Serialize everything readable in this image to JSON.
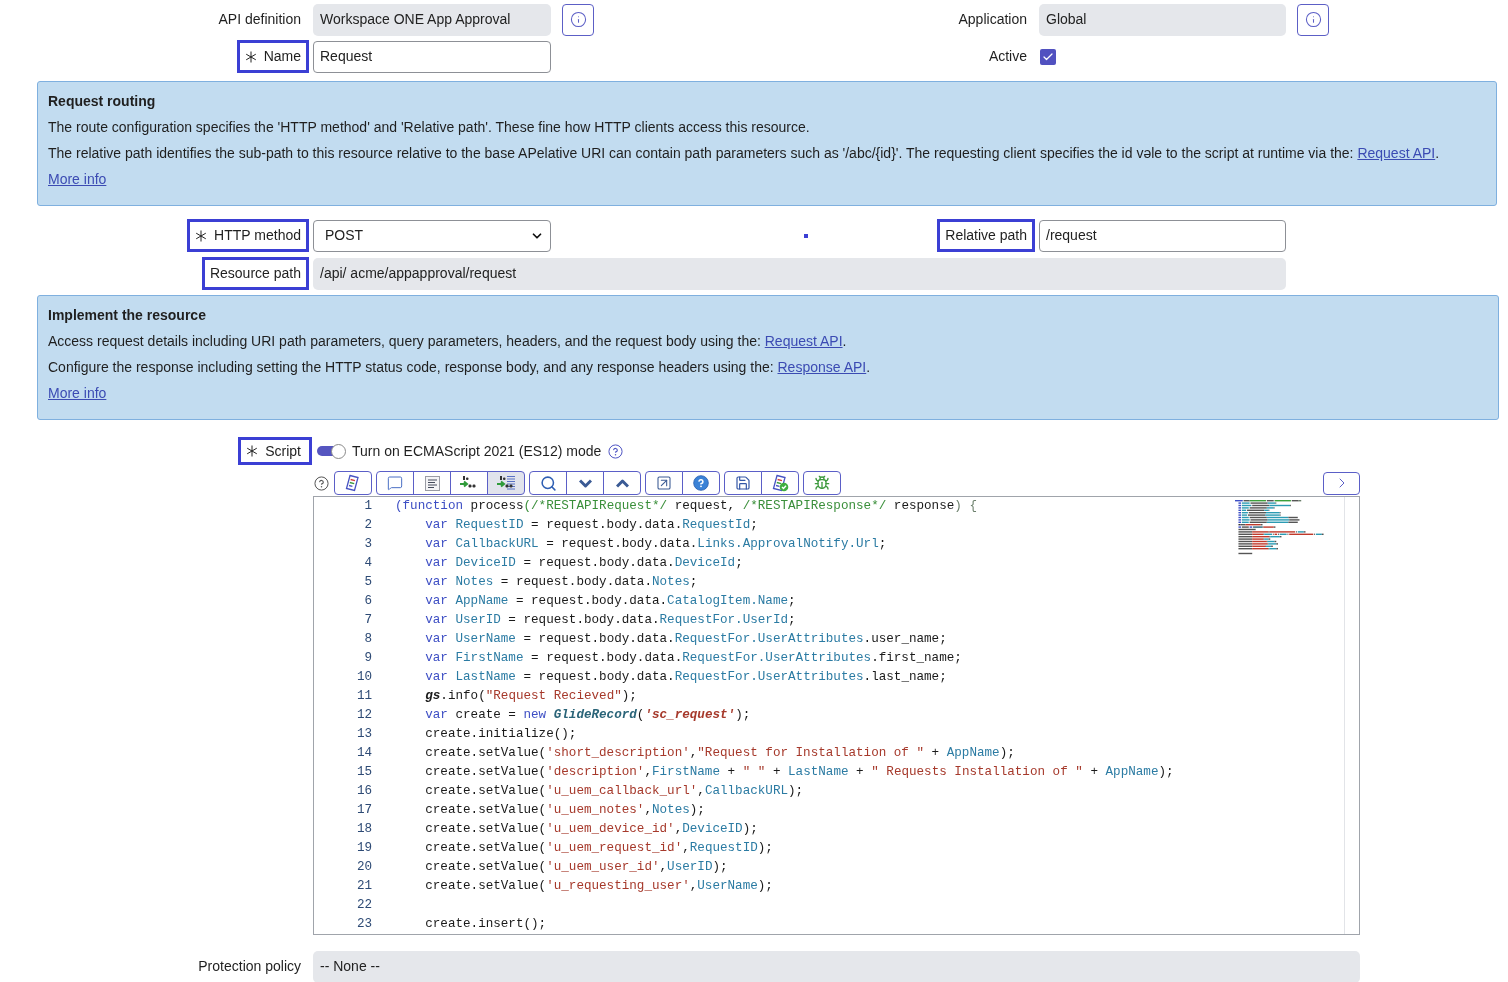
{
  "header": {
    "left": [
      {
        "kind": "readonly",
        "label": "API definition",
        "highlighted": false,
        "value": "Workspace ONE App Approval",
        "info_button": true
      },
      {
        "kind": "text",
        "label": "Name",
        "required": true,
        "highlighted": true,
        "value": "Request"
      }
    ],
    "right": [
      {
        "kind": "readonly",
        "label": "Application",
        "highlighted": false,
        "value": "Global",
        "info_button": true
      },
      {
        "kind": "checkbox",
        "label": "Active",
        "highlighted": false,
        "checked": true
      }
    ]
  },
  "request_routing": {
    "title": "Request routing",
    "paragraphs": [
      {
        "text": "The route configuration specifies the 'HTTP method' and 'Relative path'. These fine how HTTP clients access this resource."
      },
      {
        "text": "The relative path identifies the sub-path to this resource relative to the base APelative URI can contain path parameters such as '/abc/{id}'. The requesting client specifies the id vəle to the script at runtime via the: ",
        "link": "Request API",
        "text_after": "."
      }
    ],
    "more_info": "More info"
  },
  "routing_fields": {
    "http_method": {
      "kind": "select",
      "label": "HTTP method",
      "required": true,
      "highlighted": true,
      "value": "POST"
    },
    "relative_path": {
      "kind": "text",
      "label": "Relative path",
      "highlighted": true,
      "value": "/request"
    },
    "resource_path": {
      "kind": "readonly",
      "label": "Resource path",
      "highlighted": true,
      "value": "/api/ acme/appapproval/request"
    }
  },
  "implement_resource": {
    "title": "Implement the resource",
    "paragraphs": [
      {
        "text": "Access request details including URI path parameters, query parameters, headers, and the request body using the: ",
        "link": "Request API",
        "text_after": "."
      },
      {
        "text": "Configure the response including setting the HTTP status code, response body, and any response headers using the: ",
        "link": "Response API",
        "text_after": "."
      }
    ],
    "more_info": "More info"
  },
  "script": {
    "label": "Script",
    "required": true,
    "highlighted": true,
    "toggle": {
      "label": "Turn on ECMAScript 2021 (ES12) mode",
      "on": true
    },
    "toolbar": [
      {
        "buttons": [
          {
            "kind": "scroll",
            "active": false
          }
        ]
      },
      {
        "buttons": [
          {
            "kind": "bubble",
            "active": false
          },
          {
            "kind": "lines",
            "active": false
          },
          {
            "kind": "swap",
            "active": false
          },
          {
            "kind": "swaplines",
            "active": true
          }
        ]
      },
      {
        "buttons": [
          {
            "kind": "magnifier",
            "active": false
          },
          {
            "kind": "down",
            "active": false
          },
          {
            "kind": "up",
            "active": false
          }
        ]
      },
      {
        "buttons": [
          {
            "kind": "popout",
            "active": false
          },
          {
            "kind": "question",
            "active": false
          }
        ]
      },
      {
        "buttons": [
          {
            "kind": "floppy",
            "active": false
          },
          {
            "kind": "scrollcheck",
            "active": false
          }
        ]
      },
      {
        "buttons": [
          {
            "kind": "bug",
            "active": false
          }
        ]
      }
    ],
    "lines": [
      {
        "number": "1",
        "tokens": [
          {
            "kind": "keyword",
            "text": "(function"
          },
          {
            "kind": "plain",
            "text": " process"
          },
          {
            "kind": "comment",
            "text": "(/*RESTAPIRequest*/"
          },
          {
            "kind": "plain",
            "text": " request, "
          },
          {
            "kind": "comment",
            "text": "/*RESTAPIResponse*/"
          },
          {
            "kind": "plain",
            "text": " response"
          },
          {
            "kind": "bracket",
            "text": ") {"
          }
        ]
      },
      {
        "number": "2",
        "tokens": [
          {
            "kind": "keyword",
            "text": "    var"
          },
          {
            "kind": "variable",
            "text": " RequestID"
          },
          {
            "kind": "plain",
            "text": " = request.body.data."
          },
          {
            "kind": "variable",
            "text": "RequestId"
          },
          {
            "kind": "plain",
            "text": ";"
          }
        ]
      },
      {
        "number": "3",
        "tokens": [
          {
            "kind": "keyword",
            "text": "    var"
          },
          {
            "kind": "variable",
            "text": " CallbackURL"
          },
          {
            "kind": "plain",
            "text": " = request.body.data."
          },
          {
            "kind": "variable",
            "text": "Links.ApprovalNotify.Url"
          },
          {
            "kind": "plain",
            "text": ";"
          }
        ]
      },
      {
        "number": "4",
        "tokens": [
          {
            "kind": "keyword",
            "text": "    var"
          },
          {
            "kind": "variable",
            "text": " DeviceID"
          },
          {
            "kind": "plain",
            "text": " = request.body.data."
          },
          {
            "kind": "variable",
            "text": "DeviceId"
          },
          {
            "kind": "plain",
            "text": ";"
          }
        ]
      },
      {
        "number": "5",
        "tokens": [
          {
            "kind": "keyword",
            "text": "    var"
          },
          {
            "kind": "variable",
            "text": " Notes"
          },
          {
            "kind": "plain",
            "text": " = request.body.data."
          },
          {
            "kind": "variable",
            "text": "Notes"
          },
          {
            "kind": "plain",
            "text": ";"
          }
        ]
      },
      {
        "number": "6",
        "tokens": [
          {
            "kind": "keyword",
            "text": "    var"
          },
          {
            "kind": "variable",
            "text": " AppName"
          },
          {
            "kind": "plain",
            "text": " = request.body.data."
          },
          {
            "kind": "variable",
            "text": "CatalogItem.Name"
          },
          {
            "kind": "plain",
            "text": ";"
          }
        ]
      },
      {
        "number": "7",
        "tokens": [
          {
            "kind": "keyword",
            "text": "    var"
          },
          {
            "kind": "variable",
            "text": " UserID"
          },
          {
            "kind": "plain",
            "text": " = request.body.data."
          },
          {
            "kind": "variable",
            "text": "RequestFor.UserId"
          },
          {
            "kind": "plain",
            "text": ";"
          }
        ]
      },
      {
        "number": "8",
        "tokens": [
          {
            "kind": "keyword",
            "text": "    var"
          },
          {
            "kind": "variable",
            "text": " UserName"
          },
          {
            "kind": "plain",
            "text": " = request.body.data."
          },
          {
            "kind": "variable",
            "text": "RequestFor.UserAttributes"
          },
          {
            "kind": "plain",
            "text": ".user_name;"
          }
        ]
      },
      {
        "number": "9",
        "tokens": [
          {
            "kind": "keyword",
            "text": "    var"
          },
          {
            "kind": "variable",
            "text": " FirstName"
          },
          {
            "kind": "plain",
            "text": " = request.body.data."
          },
          {
            "kind": "variable",
            "text": "RequestFor.UserAttributes"
          },
          {
            "kind": "plain",
            "text": ".first_name;"
          }
        ]
      },
      {
        "number": "10",
        "tokens": [
          {
            "kind": "keyword",
            "text": "    var"
          },
          {
            "kind": "variable",
            "text": " LastName"
          },
          {
            "kind": "plain",
            "text": " = request.body.data."
          },
          {
            "kind": "variable",
            "text": "RequestFor.UserAttributes"
          },
          {
            "kind": "plain",
            "text": ".last_name;"
          }
        ]
      },
      {
        "number": "11",
        "tokens": [
          {
            "kind": "global",
            "text": "    gs"
          },
          {
            "kind": "plain",
            "text": ".info("
          },
          {
            "kind": "string",
            "text": "\"Request Recieved\""
          },
          {
            "kind": "plain",
            "text": ");"
          }
        ]
      },
      {
        "number": "12",
        "tokens": [
          {
            "kind": "keyword",
            "text": "    var"
          },
          {
            "kind": "plain",
            "text": " create = "
          },
          {
            "kind": "keyword",
            "text": "new "
          },
          {
            "kind": "type",
            "text": "GlideRecord"
          },
          {
            "kind": "plain",
            "text": "("
          },
          {
            "kind": "stringem",
            "text": "'sc_request'"
          },
          {
            "kind": "plain",
            "text": ");"
          }
        ]
      },
      {
        "number": "13",
        "tokens": [
          {
            "kind": "plain",
            "text": "    create.initialize();"
          }
        ]
      },
      {
        "number": "14",
        "tokens": [
          {
            "kind": "plain",
            "text": "    create.setValue("
          },
          {
            "kind": "string",
            "text": "'short_description'"
          },
          {
            "kind": "plain",
            "text": ","
          },
          {
            "kind": "string",
            "text": "\"Request for Installation of \""
          },
          {
            "kind": "plain",
            "text": " + "
          },
          {
            "kind": "variable",
            "text": "AppName"
          },
          {
            "kind": "plain",
            "text": ");"
          }
        ]
      },
      {
        "number": "15",
        "tokens": [
          {
            "kind": "plain",
            "text": "    create.setValue("
          },
          {
            "kind": "string",
            "text": "'description'"
          },
          {
            "kind": "plain",
            "text": ","
          },
          {
            "kind": "variable",
            "text": "FirstName"
          },
          {
            "kind": "plain",
            "text": " + "
          },
          {
            "kind": "string",
            "text": "\" \""
          },
          {
            "kind": "plain",
            "text": " + "
          },
          {
            "kind": "variable",
            "text": "LastName"
          },
          {
            "kind": "plain",
            "text": " + "
          },
          {
            "kind": "string",
            "text": "\" Requests Installation of \""
          },
          {
            "kind": "plain",
            "text": " + "
          },
          {
            "kind": "variable",
            "text": "AppName"
          },
          {
            "kind": "plain",
            "text": ");"
          }
        ]
      },
      {
        "number": "16",
        "tokens": [
          {
            "kind": "plain",
            "text": "    create.setValue("
          },
          {
            "kind": "string",
            "text": "'u_uem_callback_url'"
          },
          {
            "kind": "plain",
            "text": ","
          },
          {
            "kind": "variable",
            "text": "CallbackURL"
          },
          {
            "kind": "plain",
            "text": ");"
          }
        ]
      },
      {
        "number": "17",
        "tokens": [
          {
            "kind": "plain",
            "text": "    create.setValue("
          },
          {
            "kind": "string",
            "text": "'u_uem_notes'"
          },
          {
            "kind": "plain",
            "text": ","
          },
          {
            "kind": "variable",
            "text": "Notes"
          },
          {
            "kind": "plain",
            "text": ");"
          }
        ]
      },
      {
        "number": "18",
        "tokens": [
          {
            "kind": "plain",
            "text": "    create.setValue("
          },
          {
            "kind": "string",
            "text": "'u_uem_device_id'"
          },
          {
            "kind": "plain",
            "text": ","
          },
          {
            "kind": "variable",
            "text": "DeviceID"
          },
          {
            "kind": "plain",
            "text": ");"
          }
        ]
      },
      {
        "number": "19",
        "tokens": [
          {
            "kind": "plain",
            "text": "    create.setValue("
          },
          {
            "kind": "string",
            "text": "'u_uem_request_id'"
          },
          {
            "kind": "plain",
            "text": ","
          },
          {
            "kind": "variable",
            "text": "RequestID"
          },
          {
            "kind": "plain",
            "text": ");"
          }
        ]
      },
      {
        "number": "20",
        "tokens": [
          {
            "kind": "plain",
            "text": "    create.setValue("
          },
          {
            "kind": "string",
            "text": "'u_uem_user_id'"
          },
          {
            "kind": "plain",
            "text": ","
          },
          {
            "kind": "variable",
            "text": "UserID"
          },
          {
            "kind": "plain",
            "text": ");"
          }
        ]
      },
      {
        "number": "21",
        "tokens": [
          {
            "kind": "plain",
            "text": "    create.setValue("
          },
          {
            "kind": "string",
            "text": "'u_requesting_user'"
          },
          {
            "kind": "plain",
            "text": ","
          },
          {
            "kind": "variable",
            "text": "UserName"
          },
          {
            "kind": "plain",
            "text": ");"
          }
        ]
      },
      {
        "number": "22"
      },
      {
        "number": "23",
        "tokens": [
          {
            "kind": "plain",
            "text": "    create.insert();"
          }
        ]
      }
    ]
  },
  "protection_policy": {
    "kind": "readonly",
    "label": "Protection policy",
    "highlighted": false,
    "value": "-- None --"
  }
}
